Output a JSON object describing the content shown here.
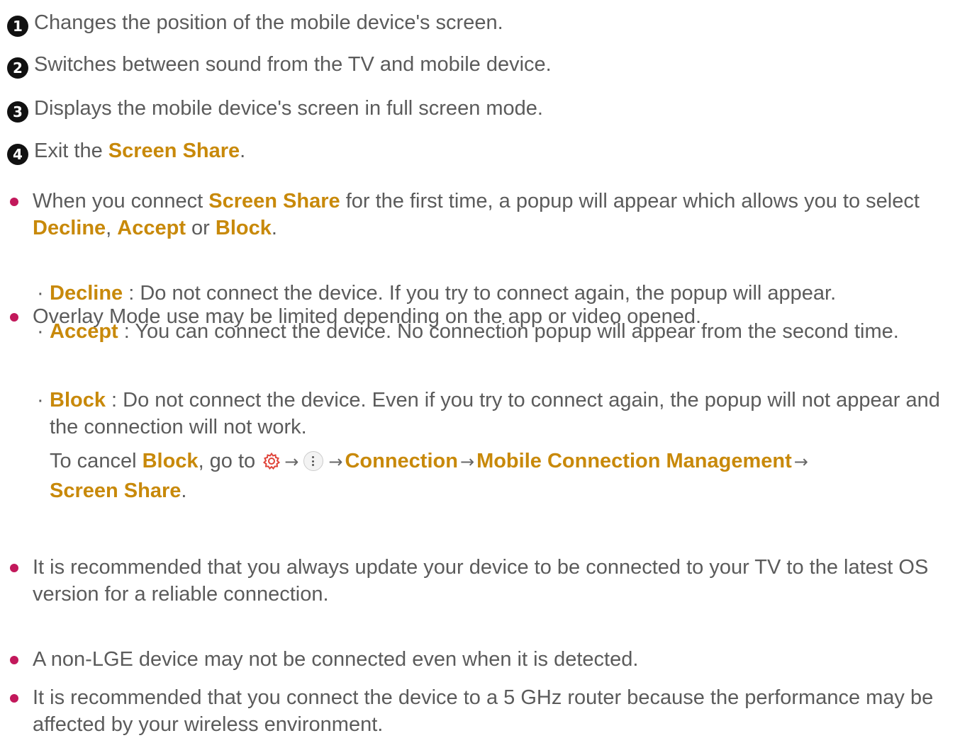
{
  "numbered": [
    {
      "num": "1",
      "text": "Changes the position of the mobile device's screen."
    },
    {
      "num": "2",
      "text": "Switches between sound from the TV and mobile device."
    },
    {
      "num": "3",
      "text": "Displays the mobile device's screen in full screen mode."
    },
    {
      "num": "4",
      "text_pre": "Exit the ",
      "highlight": "Screen Share",
      "text_post": "."
    }
  ],
  "note1": {
    "p1": "When you connect ",
    "h1": "Screen Share",
    "p2": " for the first time, a popup will appear which allows you to select ",
    "h2": "Decline",
    "p3": ", ",
    "h3": "Accept",
    "p4": " or ",
    "h4": "Block",
    "p5": "."
  },
  "options": [
    {
      "label": "Decline",
      "text": " : Do not connect the device. If you try to connect again, the popup will appear."
    },
    {
      "label": "Accept",
      "text": " : You can connect the device. No connection popup will appear from the second time."
    },
    {
      "label": "Block",
      "text": " : Do not connect the device. Even if you try to connect again, the popup will not appear and the connection will not work."
    }
  ],
  "cancel": {
    "p1": "To cancel ",
    "h1": "Block",
    "p2": ", go to ",
    "arrow": "→",
    "h2": "Connection",
    "h3": "Mobile Connection Management",
    "h4": "Screen Share",
    "p3": "."
  },
  "sub_mark": "·",
  "notes": [
    "Overlay Mode use may be limited depending on the app or video opened.",
    "It is recommended that you always update your device to be connected to your TV to the latest OS version for a reliable connection.",
    "A non-LGE device may not be connected even when it is detected.",
    "It is recommended that you connect the device to a 5 GHz router because the performance may be affected by your wireless environment."
  ],
  "colors": {
    "text": "#5b5b5b",
    "highlight": "#c8890a",
    "bullet": "#c2185b",
    "badge": "#111111",
    "gear": "#e0443a"
  },
  "icons": {
    "settings": "gear-icon",
    "more": "more-vertical-icon"
  }
}
